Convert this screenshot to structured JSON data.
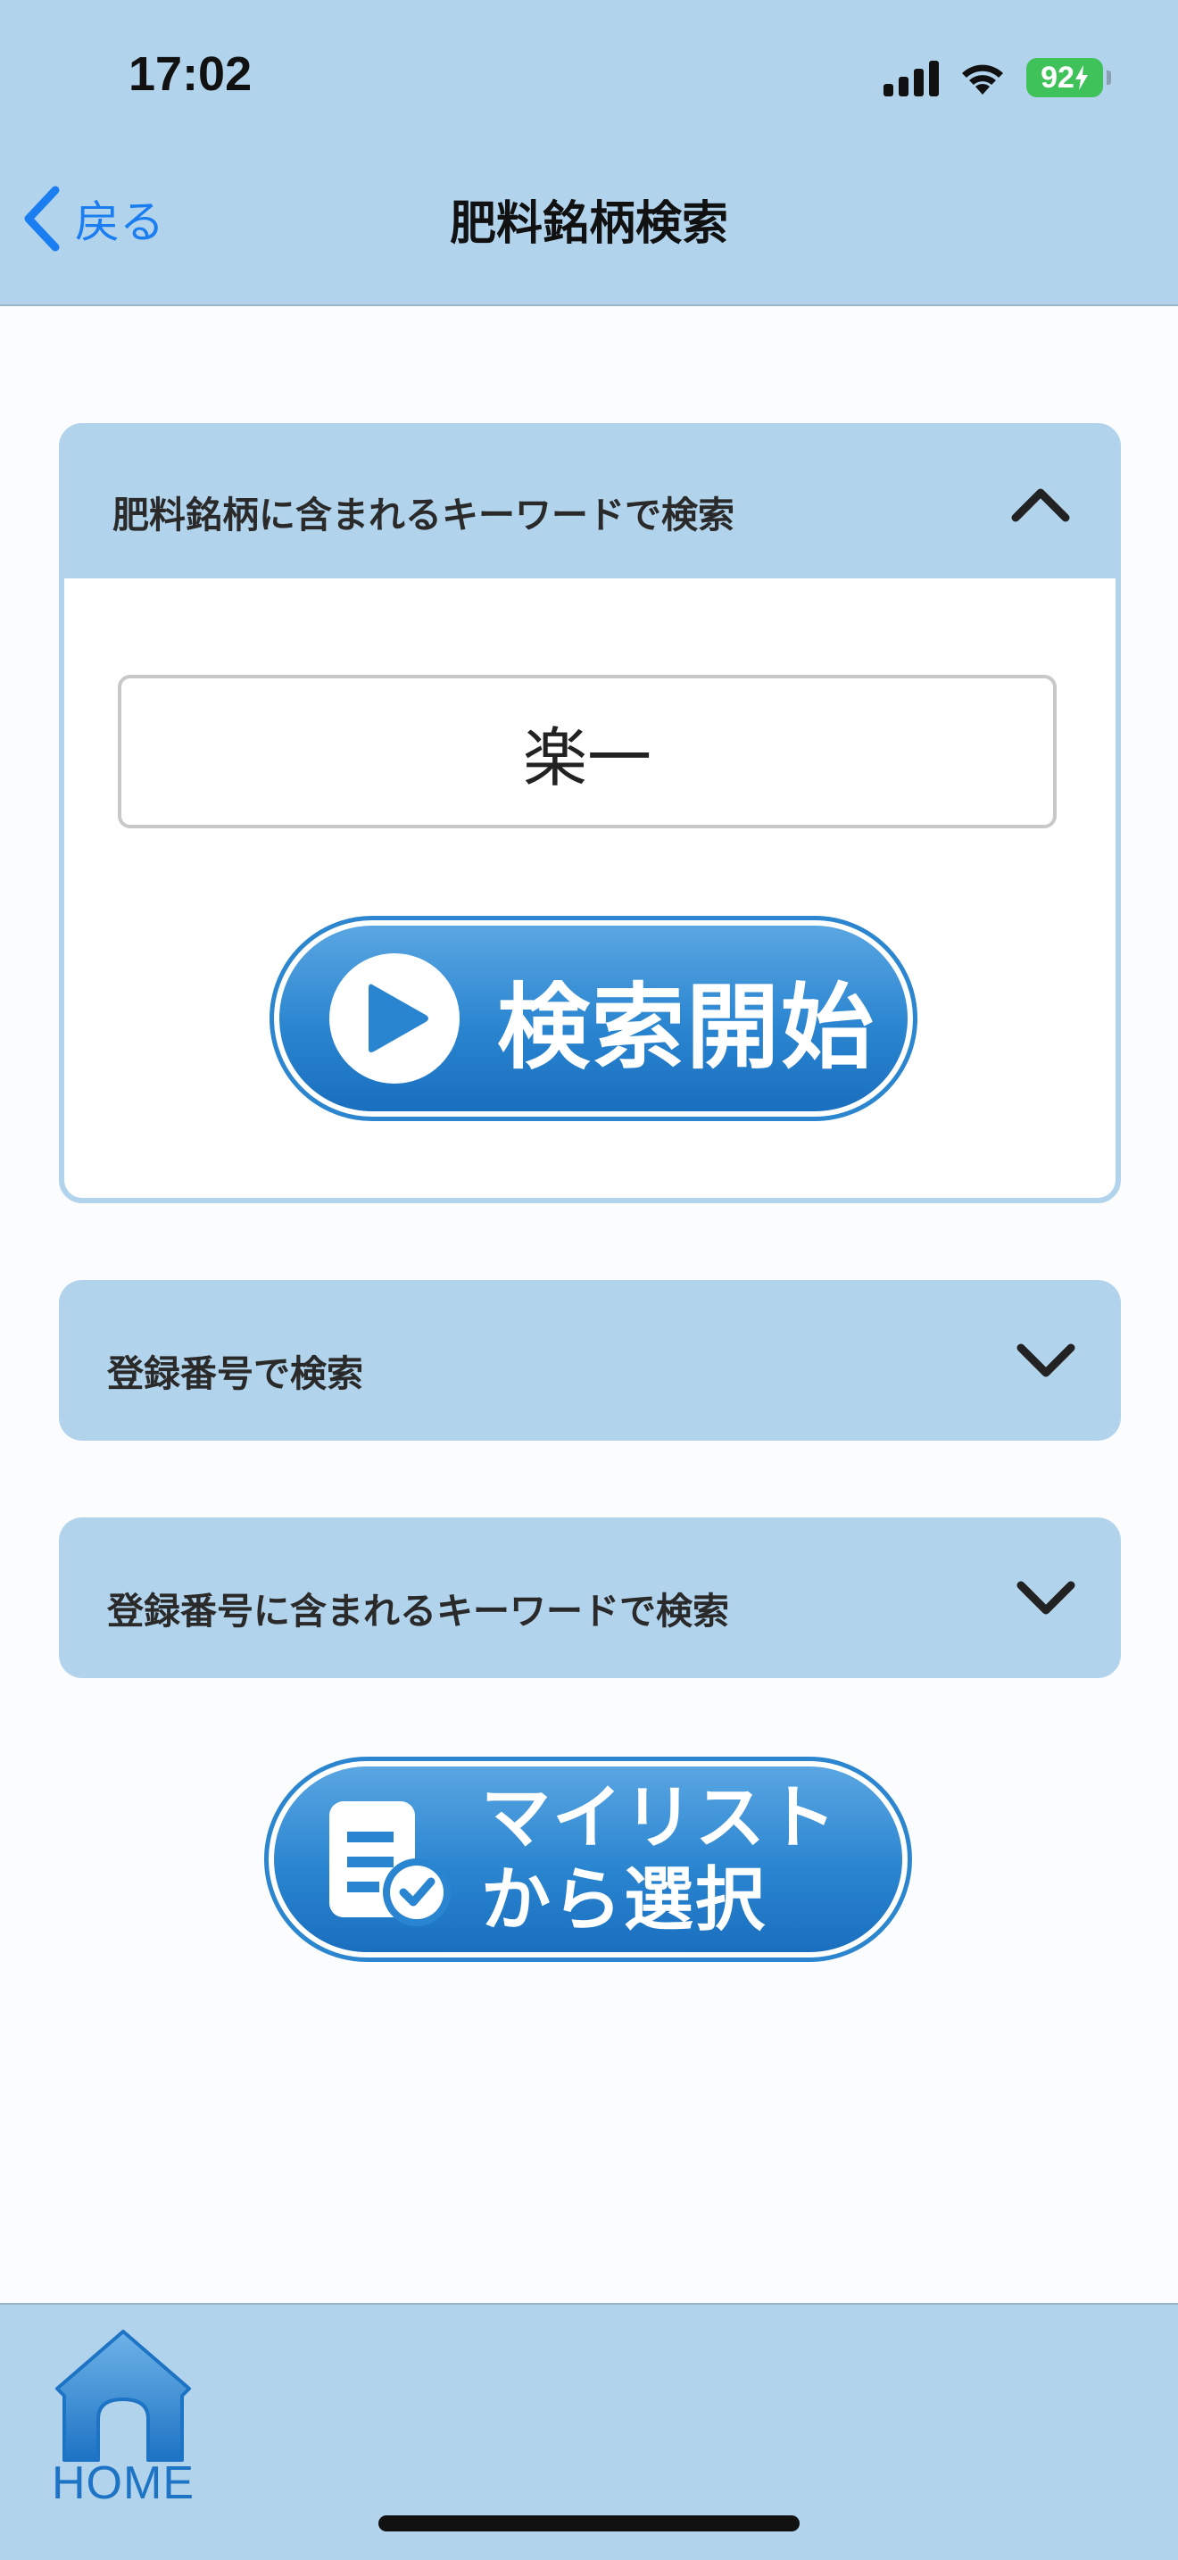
{
  "status_bar": {
    "time": "17:02",
    "battery": "92"
  },
  "nav": {
    "back_label": "戻る",
    "title": "肥料銘柄検索"
  },
  "panels": [
    {
      "label": "肥料銘柄に含まれるキーワードで検索",
      "expanded": true,
      "input_value": "楽一",
      "action_label": "検索開始"
    },
    {
      "label": "登録番号で検索",
      "expanded": false
    },
    {
      "label": "登録番号に含まれるキーワードで検索",
      "expanded": false
    }
  ],
  "mylist_button": {
    "line1": "マイリスト",
    "line2": "から選択"
  },
  "bottom_nav": {
    "home_label": "HOME"
  },
  "colors": {
    "header_bg": "#b2d3ec",
    "accent_blue": "#1b7ef0",
    "button_blue": "#2a85d0",
    "battery_green": "#3fc25a"
  }
}
